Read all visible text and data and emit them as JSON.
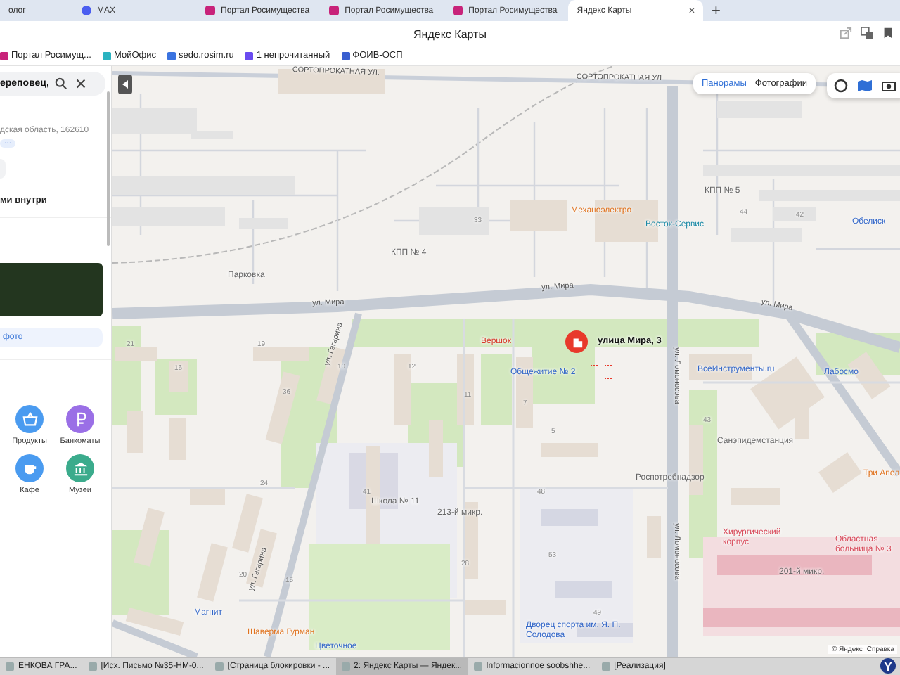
{
  "browser": {
    "tabs": [
      {
        "label": "олог",
        "selected": false
      },
      {
        "label": "MAX",
        "selected": false
      },
      {
        "label": "Портал Росимущества",
        "selected": false
      },
      {
        "label": "Портал Росимущества",
        "selected": false
      },
      {
        "label": "Портал Росимущества",
        "selected": false
      },
      {
        "label": "Яндекс Карты",
        "selected": true
      }
    ],
    "new_tab": "+",
    "close": "×",
    "title": "Яндекс Карты",
    "bookmarks": [
      "Портал Росимущ...",
      "МойОфис",
      "sedo.rosim.ru",
      "1 непрочитанный",
      "ФОИВ-ОСП"
    ]
  },
  "sidebar": {
    "search": {
      "value": "ереповец,"
    },
    "address": "дская область, 162610",
    "more": "···",
    "section_title": "ми внутри",
    "photo_link": "фото",
    "categories": [
      {
        "label": "Продукты",
        "color": "#4a9bf0",
        "kind": "basket"
      },
      {
        "label": "Банкоматы",
        "color": "#9a6fe6",
        "kind": "ruble"
      },
      {
        "label": "Кафе",
        "color": "#4a9bf0",
        "kind": "cup"
      },
      {
        "label": "Музеи",
        "color": "#3bab8c",
        "kind": "museum"
      }
    ]
  },
  "map": {
    "modes": [
      {
        "label": "Панорамы",
        "selected": true
      },
      {
        "label": "Фотографии",
        "selected": false
      }
    ],
    "pin": {
      "label": "улица Мира, 3"
    },
    "labels": [
      {
        "text": "СОРТОПРОКАТНАЯ УЛ.",
        "kind": "street"
      },
      {
        "text": "СОРТОПРОКАТНАЯ УЛ",
        "kind": "street"
      },
      {
        "text": "КПП № 4",
        "kind": "place"
      },
      {
        "text": "Парковка",
        "kind": "place"
      },
      {
        "text": "КПП № 5",
        "kind": "place"
      },
      {
        "text": "Механоэлектро",
        "kind": "food"
      },
      {
        "text": "Восток-Сервис",
        "kind": "service"
      },
      {
        "text": "Обелиск",
        "kind": "poi"
      },
      {
        "text": "ул. Мира",
        "kind": "street"
      },
      {
        "text": "ул. Мира",
        "kind": "street"
      },
      {
        "text": "ул. Мира",
        "kind": "street"
      },
      {
        "text": "Вершок",
        "kind": "red"
      },
      {
        "text": "Общежитие № 2",
        "kind": "poi"
      },
      {
        "text": "ВсеИнструменты.ru",
        "kind": "poi"
      },
      {
        "text": "Лабосмо",
        "kind": "poi"
      },
      {
        "text": "Санэпидемстанция",
        "kind": "place"
      },
      {
        "text": "Роспотребнадзор",
        "kind": "place"
      },
      {
        "text": "Три Апел",
        "kind": "food"
      },
      {
        "text": "ул. Гагарина",
        "kind": "street"
      },
      {
        "text": "ул. Гагарина",
        "kind": "street"
      },
      {
        "text": "ул. Ломоносова",
        "kind": "street"
      },
      {
        "text": "ул. Ломоносова",
        "kind": "street"
      },
      {
        "text": "Школа № 11",
        "kind": "place"
      },
      {
        "text": "213-й микр.",
        "kind": "place"
      },
      {
        "text": "Хирургический корпус",
        "kind": "medical"
      },
      {
        "text": "Областная больница № 3",
        "kind": "medical"
      },
      {
        "text": "201-й микр.",
        "kind": "place"
      },
      {
        "text": "Магнит",
        "kind": "poi"
      },
      {
        "text": "Шаверма Гурман",
        "kind": "food"
      },
      {
        "text": "Цветочное",
        "kind": "poi"
      },
      {
        "text": "Дворец спорта им. Я. П. Солодова",
        "kind": "poi"
      },
      {
        "text": "21",
        "kind": "house"
      },
      {
        "text": "19",
        "kind": "house"
      },
      {
        "text": "16",
        "kind": "house"
      },
      {
        "text": "10",
        "kind": "house"
      },
      {
        "text": "12",
        "kind": "house"
      },
      {
        "text": "11",
        "kind": "house"
      },
      {
        "text": "7",
        "kind": "house"
      },
      {
        "text": "36",
        "kind": "house"
      },
      {
        "text": "33",
        "kind": "house"
      },
      {
        "text": "44",
        "kind": "house"
      },
      {
        "text": "42",
        "kind": "house"
      },
      {
        "text": "41",
        "kind": "house"
      },
      {
        "text": "48",
        "kind": "house"
      },
      {
        "text": "53",
        "kind": "house"
      },
      {
        "text": "49",
        "kind": "house"
      },
      {
        "text": "28",
        "kind": "house"
      },
      {
        "text": "24",
        "kind": "house"
      },
      {
        "text": "20",
        "kind": "house"
      },
      {
        "text": "15",
        "kind": "house"
      },
      {
        "text": "5",
        "kind": "house"
      },
      {
        "text": "43",
        "kind": "house"
      }
    ],
    "copyright": "© Яндекс",
    "help": "Справка"
  },
  "taskbar": [
    {
      "label": "ЕНКОВА ГРА...",
      "selected": false
    },
    {
      "label": "[Исх. Письмо №35-НМ-0...",
      "selected": false
    },
    {
      "label": "[Страница блокировки - ...",
      "selected": false
    },
    {
      "label": "2: Яндекс Карты — Яндек...",
      "selected": true
    },
    {
      "label": "Informacionnoe soobshhe...",
      "selected": false
    },
    {
      "label": "[Реализация]",
      "selected": false
    }
  ]
}
